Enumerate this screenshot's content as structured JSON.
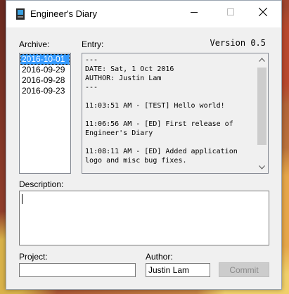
{
  "window": {
    "title": "Engineer's Diary",
    "icon": "notebook-icon"
  },
  "titlebar_buttons": {
    "minimize": "minimize-icon",
    "maximize": "maximize-icon",
    "close": "close-icon"
  },
  "archive": {
    "label": "Archive:",
    "items": [
      "2016-10-01",
      "2016-09-29",
      "2016-09-28",
      "2016-09-23"
    ],
    "selected_index": 0
  },
  "entry": {
    "label": "Entry:",
    "version": "Version 0.5",
    "text": "---\nDATE: Sat, 1 Oct 2016\nAUTHOR: Justin Lam\n---\n\n11:03:51 AM - [TEST] Hello world!\n\n11:06:56 AM - [ED] First release of Engineer's Diary\n\n11:08:11 AM - [ED] Added application logo and misc bug fixes."
  },
  "description": {
    "label": "Description:",
    "value": ""
  },
  "project": {
    "label": "Project:",
    "value": ""
  },
  "author": {
    "label": "Author:",
    "value": "Justin Lam"
  },
  "commit": {
    "label": "Commit",
    "enabled": false
  }
}
